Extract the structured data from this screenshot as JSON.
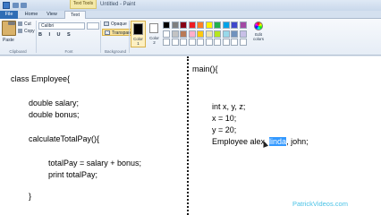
{
  "window": {
    "context_tab": "Text Tools",
    "title": "Untitled - Paint"
  },
  "tabs": [
    "File",
    "Home",
    "View",
    "Text"
  ],
  "ribbon": {
    "clipboard": {
      "paste": "Paste",
      "cut": "Cut",
      "copy": "Copy",
      "label": "Clipboard"
    },
    "font": {
      "family": "Calibri",
      "label": "Font"
    },
    "background": {
      "opaque": "Opaque",
      "transparent": "Transparent",
      "label": "Background"
    },
    "colors": {
      "color1_line1": "Color",
      "color1_line2": "1",
      "color2_line1": "Color",
      "color2_line2": "2",
      "edit_line1": "Edit",
      "edit_line2": "colors",
      "palette": [
        "#000000",
        "#7f7f7f",
        "#880015",
        "#ed1c24",
        "#ff7f27",
        "#fff200",
        "#22b14c",
        "#00a2e8",
        "#3f48cc",
        "#a349a4",
        "#ffffff",
        "#c3c3c3",
        "#b97a57",
        "#ffaec9",
        "#ffc90e",
        "#efe4b0",
        "#b5e61d",
        "#99d9ea",
        "#7092be",
        "#c8bfe7",
        "#ffffff",
        "#ffffff",
        "#ffffff",
        "#ffffff",
        "#ffffff",
        "#ffffff",
        "#ffffff",
        "#ffffff",
        "#ffffff",
        "#ffffff"
      ]
    }
  },
  "left_code": {
    "line1": "class Employee{",
    "line2": "double salary;",
    "line3": "double bonus;",
    "line4": "calculateTotalPay(){",
    "line5": "totalPay = salary + bonus;",
    "line6": "print totalPay;",
    "line7": "}"
  },
  "right_code": {
    "line1": "main(){",
    "line2": "int x, y, z;",
    "line3": "x = 10;",
    "line4": "y = 20;",
    "line5_before": "Employee alex, ",
    "line5_selected": "linda",
    "line5_after": ", john;"
  },
  "watermark": "PatrickVideos.com"
}
